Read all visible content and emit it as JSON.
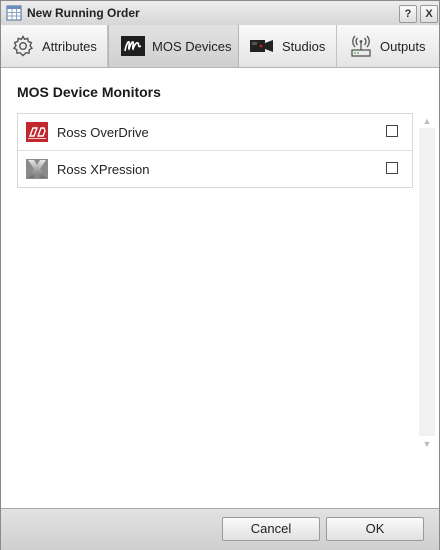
{
  "window": {
    "title": "New Running Order",
    "help_button": "?",
    "close_button": "X"
  },
  "tabs": [
    {
      "label": "Attributes",
      "icon": "gear-icon",
      "active": false
    },
    {
      "label": "MOS Devices",
      "icon": "mos-devices-icon",
      "active": true
    },
    {
      "label": "Studios",
      "icon": "camera-icon",
      "active": false
    },
    {
      "label": "Outputs",
      "icon": "antenna-icon",
      "active": false
    }
  ],
  "content": {
    "section_title": "MOS Device Monitors",
    "devices": [
      {
        "name": "Ross OverDrive",
        "icon": "ross-overdrive-logo",
        "checked": false
      },
      {
        "name": "Ross XPression",
        "icon": "ross-xpression-logo",
        "checked": false
      }
    ]
  },
  "footer": {
    "cancel_label": "Cancel",
    "ok_label": "OK"
  },
  "colors": {
    "overdrive_red": "#c0282d",
    "active_tab": "#d6d6d6"
  }
}
